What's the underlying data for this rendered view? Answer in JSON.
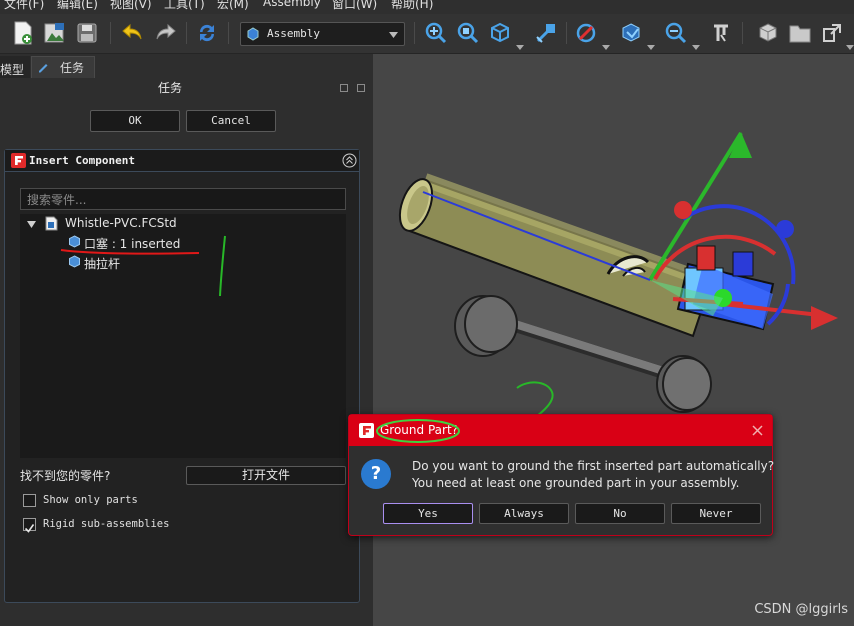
{
  "menubar": {
    "items": [
      "文件(F)",
      "编辑(E)",
      "视图(V)",
      "工具(T)",
      "宏(M)",
      "Assembly",
      "窗口(W)",
      "帮助(H)"
    ]
  },
  "toolbar": {
    "workbench": "Assembly",
    "icons": [
      "new-file-icon",
      "open-file-icon",
      "save-icon",
      "undo-icon",
      "redo-icon",
      "refresh-icon",
      "fit-all-icon",
      "fit-selection-icon",
      "std-view-icon",
      "select-area-icon",
      "draw-style-icon",
      "bounding-box-icon",
      "zoom-icon",
      "measure-icon",
      "part-icon",
      "folder-icon",
      "link-icon"
    ]
  },
  "tabs": {
    "model": "模型",
    "tasks": "任务"
  },
  "panel": {
    "title": "任务"
  },
  "buttons": {
    "ok": "OK",
    "cancel": "Cancel"
  },
  "insert_component": {
    "title": "Insert Component",
    "search_placeholder": "搜索零件...",
    "tree": {
      "root": "Whistle-PVC.FCStd",
      "children": [
        "口塞 : 1 inserted",
        "抽拉杆"
      ]
    },
    "not_found_label": "找不到您的零件?",
    "open_file_button": "打开文件",
    "show_only_parts": "Show only parts",
    "rigid_subassemblies": "Rigid sub-assemblies",
    "show_only_parts_checked": false,
    "rigid_subassemblies_checked": true
  },
  "dialog": {
    "title": "Ground Part?",
    "message_line1": "Do you want to ground the first inserted part automatically?",
    "message_line2": "You need at least one grounded part in your assembly.",
    "buttons": {
      "yes": "Yes",
      "always": "Always",
      "no": "No",
      "never": "Never"
    },
    "accent_color": "#d90015"
  },
  "annotations": {
    "one": "1",
    "two": "2"
  },
  "watermark": "CSDN @lggirls"
}
